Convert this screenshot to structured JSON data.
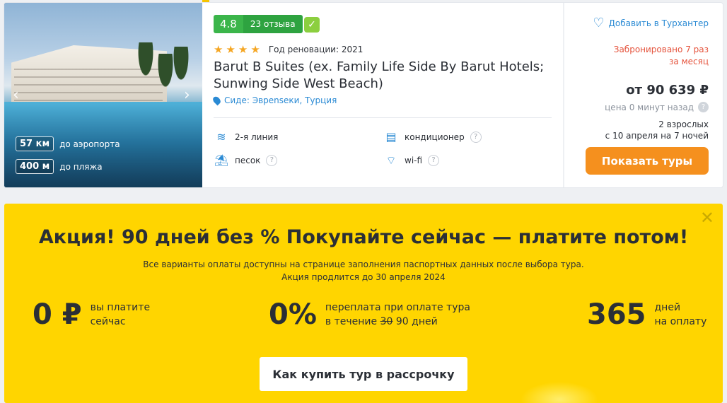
{
  "hotel": {
    "rating": "4.8",
    "reviews": "23 отзыва",
    "stars": 4,
    "renovation": "Год реновации: 2021",
    "name": "Barut B Suites (ex. Family Life Side By Barut Hotels; Sunwing Side West Beach)",
    "location": "Сиде: Эврenseки, Турция",
    "distances": [
      {
        "value": "57 км",
        "label": "до аэропорта"
      },
      {
        "value": "400 м",
        "label": "до пляжа"
      }
    ],
    "features": [
      {
        "icon": "beach-line-icon",
        "label": "2-я линия",
        "help": false
      },
      {
        "icon": "air-conditioner-icon",
        "label": "кондиционер",
        "help": true
      },
      {
        "icon": "sand-beach-icon",
        "label": "песок",
        "help": true
      },
      {
        "icon": "wifi-icon",
        "label": "wi-fi",
        "help": true
      }
    ]
  },
  "pricing": {
    "favorite_label": "Добавить в Турхантер",
    "booked": "Забронировано 7 раз за месяц",
    "price": "от 90 639 ₽",
    "price_age": "цена 0 минут назад",
    "guests": "2 взрослых",
    "dates": "с 10 апреля на 7 ночей",
    "show_button": "Показать туры"
  },
  "promo": {
    "title": "Акция! 90 дней без % Покупайте сейчас — платите потом!",
    "subtitle1": "Все варианты оплаты доступны на странице заполнения паспортных данных после выбора тура.",
    "subtitle2": "Акция продлится до 30 апреля 2024",
    "stat1_big": "0 ₽",
    "stat1_line1": "вы платите",
    "stat1_line2": "сейчас",
    "stat2_big": "0%",
    "stat2_line1": "переплата при оплате тура",
    "stat2_line2_pre": "в течение",
    "stat2_line2_struck": "30",
    "stat2_line2_post": "90 дней",
    "stat3_big": "365",
    "stat3_line1": "дней",
    "stat3_line2": "на оплату",
    "button": "Как купить тур в рассрочку"
  },
  "colors": {
    "rating_green": "#3bb54a",
    "link_blue": "#2a8ad4",
    "booked_red": "#e5533c",
    "cta_orange": "#f5901e",
    "promo_yellow": "#ffd500"
  }
}
